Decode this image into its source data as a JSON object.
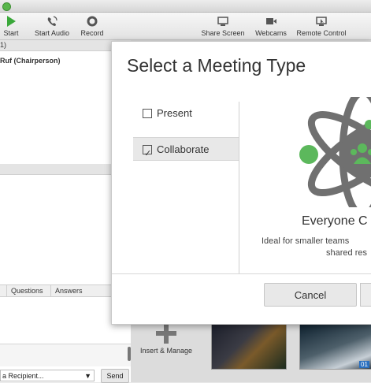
{
  "toolbar": {
    "start": "Start",
    "start_audio": "Start Audio",
    "record": "Record",
    "share_screen": "Share Screen",
    "webcams": "Webcams",
    "remote_control": "Remote Control"
  },
  "participants": {
    "header_fragment": "1)",
    "first": "Ruf (Chairperson)"
  },
  "chat": {
    "tab_questions": "Questions",
    "tab_answers": "Answers",
    "recipient": "a Recipient...",
    "send": "Send"
  },
  "content": {
    "insert_manage": "Insert & Manage",
    "thumb_label": "01"
  },
  "modal": {
    "title": "Select a Meeting Type",
    "options": [
      {
        "label": "Present",
        "selected": false
      },
      {
        "label": "Collaborate",
        "selected": true
      }
    ],
    "detail_title": "Everyone C",
    "detail_line1": "Ideal for smaller teams",
    "detail_line2": "shared res",
    "cancel": "Cancel"
  },
  "colors": {
    "accent_green": "#5cb85c",
    "icon_gray": "#707070"
  }
}
